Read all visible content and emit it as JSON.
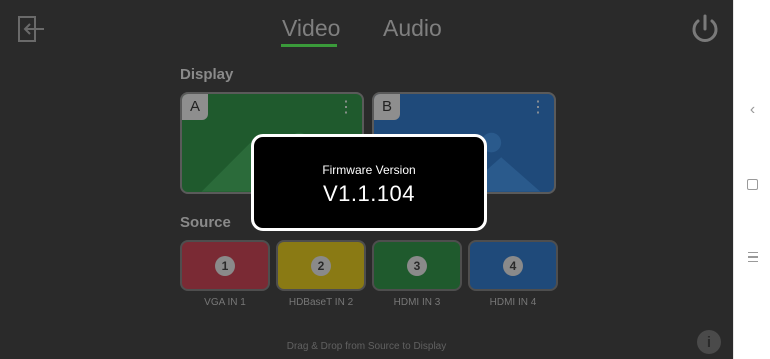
{
  "tabs": [
    "Video",
    "Audio"
  ],
  "sections": {
    "display": "Display",
    "source": "Source"
  },
  "display": {
    "a_label": "A",
    "b_label": "B"
  },
  "sources": [
    {
      "number": "1",
      "label": "VGA IN 1"
    },
    {
      "number": "2",
      "label": "HDBaseT IN 2"
    },
    {
      "number": "3",
      "label": "HDMI IN 3"
    },
    {
      "number": "4",
      "label": "HDMI IN 4"
    }
  ],
  "hint": "Drag & Drop from Source to Display",
  "modal": {
    "title": "Firmware Version",
    "value": "V1.1.104"
  },
  "nav": {
    "back_icon": "back-chevron-icon",
    "home_icon": "square-icon",
    "menu_icon": "menu-lines-icon"
  },
  "colors": {
    "accent": "#3a9a3a",
    "display_a": "#1f5a2d",
    "display_b": "#1f4a7a",
    "source_1": "#7a2a34",
    "source_2": "#8a7a14",
    "source_3": "#1f5a2d",
    "source_4": "#1f4a7a"
  },
  "icons": {
    "exit": "exit-icon",
    "power": "power-icon",
    "info": "info-icon"
  }
}
